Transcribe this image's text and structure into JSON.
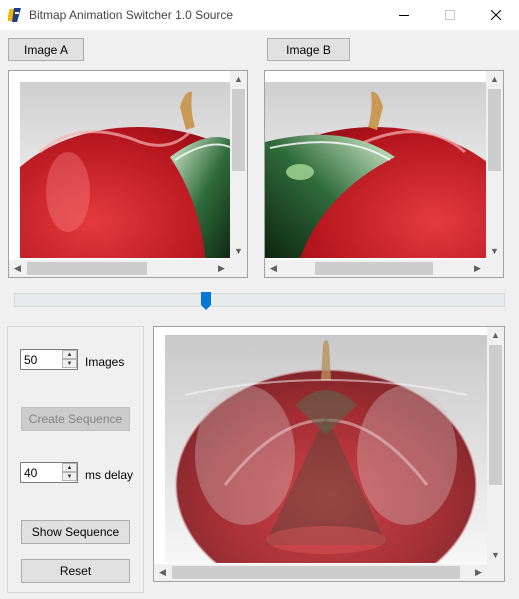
{
  "window": {
    "title": "Bitmap Animation Switcher 1.0 Source",
    "icon": "app-icon",
    "controls": [
      "minimize-icon",
      "maximize-icon",
      "close-icon"
    ]
  },
  "top_buttons": {
    "image_a": "Image A",
    "image_b": "Image B"
  },
  "slider": {
    "position": 0.39
  },
  "controls": {
    "images": {
      "value": "50",
      "label": "Images"
    },
    "create_sequence": {
      "label": "Create Sequence",
      "enabled": false
    },
    "delay": {
      "value": "40",
      "label": "ms delay"
    },
    "show_sequence": "Show Sequence",
    "reset": "Reset"
  },
  "colors": {
    "apple_red": "#b2141c",
    "apple_dark": "#5a0208",
    "leaf_green": "#2f6b3a",
    "slider_blue": "#0078d7"
  }
}
